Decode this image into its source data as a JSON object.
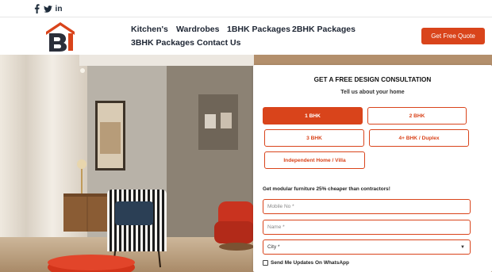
{
  "social": {
    "facebook_glyph": "f",
    "twitter_glyph": "🐦",
    "linkedin_glyph": "in"
  },
  "nav": {
    "items": [
      "Kitchen's",
      "Wardrobes",
      "1BHK Packages",
      "2BHK Packages",
      "3BHK Packages",
      "Contact Us"
    ],
    "cta_label": "Get Free Quote"
  },
  "form": {
    "title": "GET A FREE DESIGN CONSULTATION",
    "subtitle": "Tell us about your home",
    "options": [
      "1 BHK",
      "2 BHK",
      "3 BHK",
      "4+ BHK / Duplex",
      "Independent Home / Villa"
    ],
    "selected_option": "1 BHK",
    "promo": "Get modular furniture 25% cheaper than contractors!",
    "mobile_placeholder": "Mobile No *",
    "name_placeholder": "Name *",
    "city_value": "City *",
    "whatsapp_label": "Send Me Updates On WhatsApp"
  },
  "colors": {
    "accent": "#d9441b",
    "nav_text": "#1d2533"
  }
}
